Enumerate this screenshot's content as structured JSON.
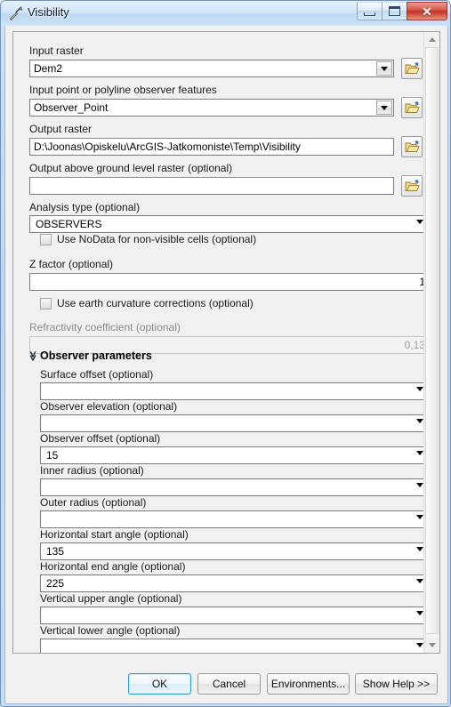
{
  "window": {
    "title": "Visibility",
    "icon": "hammer-tool-icon",
    "minimize_label": "Minimize",
    "restore_label": "Restore",
    "close_label": "Close",
    "close_glyph": "✕"
  },
  "fields": {
    "input_raster": {
      "label": "Input raster",
      "value": "Dem2",
      "browse_icon": "open-folder-icon"
    },
    "observer_features": {
      "label": "Input point or polyline observer features",
      "value": "Observer_Point",
      "browse_icon": "open-folder-icon"
    },
    "output_raster": {
      "label": "Output raster",
      "value": "D:\\Joonas\\Opiskelu\\ArcGIS-Jatkomoniste\\Temp\\Visibility",
      "browse_icon": "open-folder-icon"
    },
    "output_agl_raster": {
      "label": "Output above ground level raster (optional)",
      "value": "",
      "browse_icon": "open-folder-icon"
    },
    "analysis_type": {
      "label": "Analysis type (optional)",
      "value": "OBSERVERS"
    },
    "use_nodata": {
      "label": "Use NoData for non-visible cells (optional)",
      "checked": false
    },
    "z_factor": {
      "label": "Z factor (optional)",
      "value": "1"
    },
    "use_earth_curvature": {
      "label": "Use earth curvature corrections (optional)",
      "checked": false
    },
    "refractivity_coefficient": {
      "label": "Refractivity coefficient (optional)",
      "value": "0,13",
      "disabled": true
    }
  },
  "observer_section": {
    "title": "Observer parameters",
    "collapse_icon": "chevron-double-up-icon",
    "collapse_glyph": "≪",
    "fields": [
      {
        "label": "Surface offset (optional)",
        "value": ""
      },
      {
        "label": "Observer elevation (optional)",
        "value": ""
      },
      {
        "label": "Observer offset (optional)",
        "value": "15"
      },
      {
        "label": "Inner radius (optional)",
        "value": ""
      },
      {
        "label": "Outer radius (optional)",
        "value": ""
      },
      {
        "label": "Horizontal start angle (optional)",
        "value": "135"
      },
      {
        "label": "Horizontal end angle (optional)",
        "value": "225"
      },
      {
        "label": "Vertical upper angle (optional)",
        "value": ""
      },
      {
        "label": "Vertical lower angle (optional)",
        "value": ""
      }
    ]
  },
  "buttons": {
    "ok": "OK",
    "cancel": "Cancel",
    "environments": "Environments...",
    "show_help": "Show Help >>"
  },
  "scrollbar": {
    "up_icon": "scroll-up-arrow-icon",
    "down_icon": "scroll-down-arrow-icon"
  },
  "colors": {
    "title_bar": "#cfe4f8",
    "close_button": "#bf3526",
    "dialog_bg": "#f0f0f0",
    "default_button_border": "#2e9bd6"
  }
}
